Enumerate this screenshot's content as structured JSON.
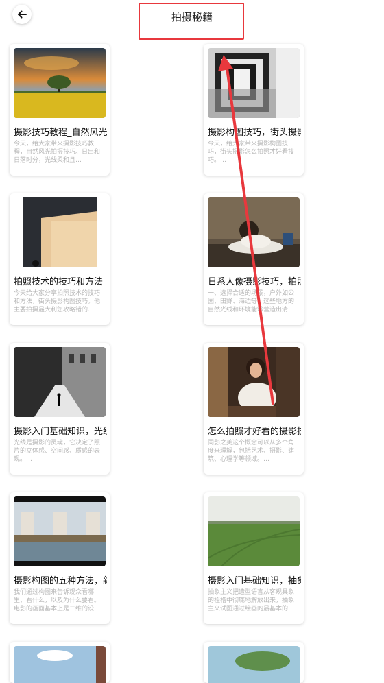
{
  "header": {
    "title": "拍摄秘籍"
  },
  "cards": [
    {
      "title": "摄影技巧教程_自然风光拍摄技巧",
      "desc": "今天，给大家带来摄影技巧教程，自然风光拍摄技巧。日出和日落时分，光线柔和且…"
    },
    {
      "title": "摄影构图技巧，街头摄影",
      "desc": "今天，给大家带来摄影构图技巧，街头摄影怎么拍照才好看技巧。…"
    },
    {
      "title": "拍照技术的技巧和方法",
      "desc": "今天给大家分享拍照技术的技巧和方法，街头摄影构图技巧。他主要拍摄最大利您攻略错的…"
    },
    {
      "title": "日系人像摄影技巧，拍照…",
      "desc": "一、选择合适的场景，户外如公园、田野、海边等，这些地方的自然光线和环境能够营造出清…"
    },
    {
      "title": "摄影入门基础知识，光线…",
      "desc": "光线是摄影的灵魂，它决定了照片的立体感、空间感、质感的表现。…"
    },
    {
      "title": "怎么拍照才好看的摄影技巧",
      "desc": "同影之美这个概念可以从多个角度来理解，包括艺术、摄影、建筑、心理学等领域。…"
    },
    {
      "title": "摄影构图的五种方法，新手",
      "desc": "我们通过构图来告诉观众看哪里、看什么，以及为什么要看。电影的画面基本上是二维的设…"
    },
    {
      "title": "摄影入门基础知识，抽象",
      "desc": "抽象主义把造型语言从客观具象的桎梏中彻底地解放出来，抽象主义试图通过绘画的最基本的…"
    },
    {
      "title": "",
      "desc": ""
    },
    {
      "title": "",
      "desc": ""
    }
  ]
}
